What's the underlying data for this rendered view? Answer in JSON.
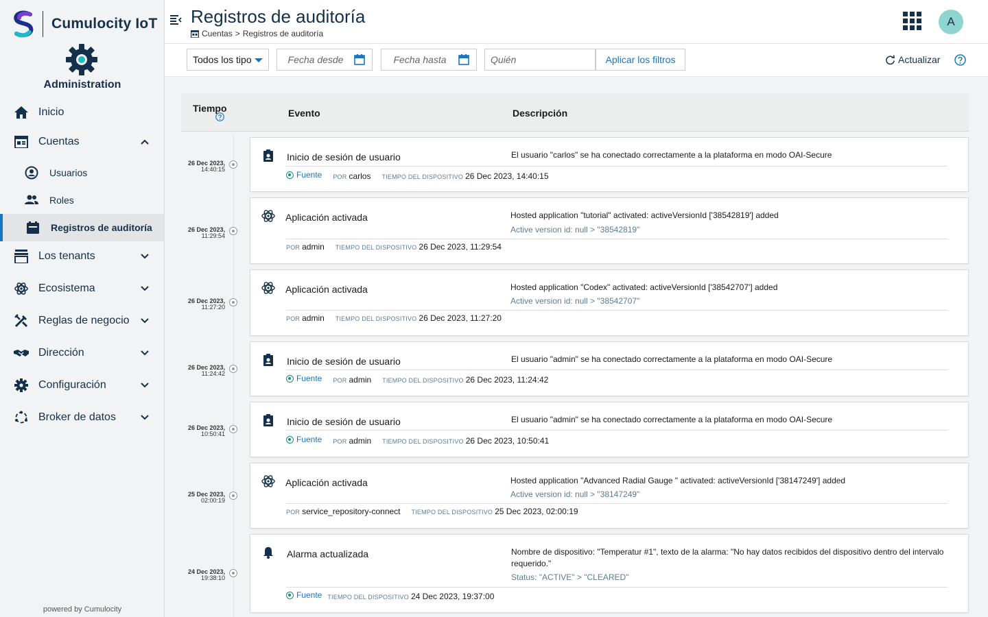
{
  "brand": {
    "name": "Cumulocity IoT",
    "app_name": "Administration",
    "powered_by": "powered by Cumulocity"
  },
  "nav": {
    "home": "Inicio",
    "accounts": "Cuentas",
    "users": "Usuarios",
    "roles": "Roles",
    "audit": "Registros de auditoría",
    "tenants": "Los tenants",
    "ecosystem": "Ecosistema",
    "business_rules": "Reglas de negocio",
    "management": "Dirección",
    "settings": "Configuración",
    "data_broker": "Broker de datos"
  },
  "header": {
    "title": "Registros de auditoría",
    "breadcrumb_parent": "Cuentas",
    "breadcrumb_sep": ">",
    "breadcrumb_current": "Registros de auditoría",
    "avatar_initial": "A"
  },
  "filters": {
    "type_value": "Todos los tipo",
    "date_from_placeholder": "Fecha desde",
    "date_to_placeholder": "Fecha hasta",
    "who_placeholder": "Quién",
    "apply_label": "Aplicar los filtros",
    "refresh_label": "Actualizar"
  },
  "table": {
    "col_time": "Tiempo",
    "col_event": "Evento",
    "col_desc": "Descripción"
  },
  "labels": {
    "source": "Fuente",
    "by": "POR",
    "device_time": "TIEMPO DEL DISPOSITIVO"
  },
  "rows": [
    {
      "date": "26 Dec 2023,",
      "time": "14:40:15",
      "icon": "user-login-icon",
      "event": "Inicio de sesión de usuario",
      "desc": "El usuario \"carlos\" se ha conectado correctamente a la plataforma en modo OAI-Secure",
      "change": "",
      "by": "carlos",
      "device_time": "26 Dec 2023, 14:40:15"
    },
    {
      "date": "26 Dec 2023,",
      "time": "11:29:54",
      "icon": "atom-icon",
      "event": "Aplicación activada",
      "desc": "Hosted application \"tutorial\" activated: activeVersionId ['38542819'] added",
      "change": "Active version id: null > \"38542819\"",
      "by": "admin",
      "device_time": "26 Dec 2023, 11:29:54"
    },
    {
      "date": "26 Dec 2023,",
      "time": "11:27:20",
      "icon": "atom-icon",
      "event": "Aplicación activada",
      "desc": "Hosted application \"Codex\" activated: activeVersionId ['38542707'] added",
      "change": "Active version id: null > \"38542707\"",
      "by": "admin",
      "device_time": "26 Dec 2023, 11:27:20"
    },
    {
      "date": "26 Dec 2023,",
      "time": "11:24:42",
      "icon": "user-login-icon",
      "event": "Inicio de sesión de usuario",
      "desc": "El usuario \"admin\" se ha conectado correctamente a la plataforma en modo OAI-Secure",
      "change": "",
      "by": "admin",
      "device_time": "26 Dec 2023, 11:24:42"
    },
    {
      "date": "26 Dec 2023,",
      "time": "10:50:41",
      "icon": "user-login-icon",
      "event": "Inicio de sesión de usuario",
      "desc": "El usuario \"admin\" se ha conectado correctamente a la plataforma en modo OAI-Secure",
      "change": "",
      "by": "admin",
      "device_time": "26 Dec 2023, 10:50:41"
    },
    {
      "date": "25 Dec 2023,",
      "time": "02:00:19",
      "icon": "atom-icon",
      "event": "Aplicación activada",
      "desc": "Hosted application \"Advanced Radial Gauge \" activated: activeVersionId ['38147249'] added",
      "change": "Active version id: null > \"38147249\"",
      "by": "service_repository-connect",
      "device_time": "25 Dec 2023, 02:00:19"
    },
    {
      "date": "24 Dec 2023,",
      "time": "19:38:10",
      "icon": "bell-icon",
      "event": "Alarma actualizada",
      "desc": "Nombre de dispositivo: \"Temperatur #1\", texto de la alarma: \"No hay datos recibidos del dispositivo dentro del intervalo requerido.\"",
      "change": "Status: \"ACTIVE\" > \"CLEARED\"",
      "by": "",
      "device_time": "24 Dec 2023, 19:37:00"
    }
  ],
  "colors": {
    "primary": "#1776bf",
    "navy": "#14304a",
    "accent_teal": "#0a8f8a",
    "avatar_bg": "#8ed4d0"
  }
}
